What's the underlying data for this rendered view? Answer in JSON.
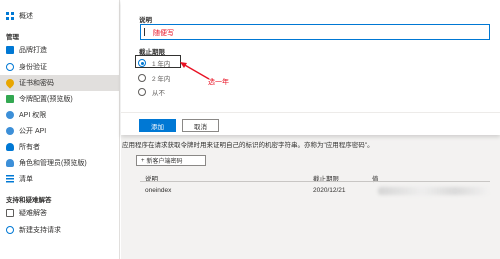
{
  "sidebar": {
    "items": [
      {
        "label": "概述",
        "icon": "grid-icon"
      },
      {
        "label": "品牌打造",
        "icon": "brand-icon"
      },
      {
        "label": "身份验证",
        "icon": "auth-icon"
      },
      {
        "label": "证书和密码",
        "icon": "key-icon",
        "selected": true
      },
      {
        "label": "令牌配置(预览版)",
        "icon": "token-icon"
      },
      {
        "label": "API 权限",
        "icon": "api-icon"
      },
      {
        "label": "公开 API",
        "icon": "cloud-icon"
      },
      {
        "label": "所有者",
        "icon": "owner-icon"
      },
      {
        "label": "角色和管理员(预览版)",
        "icon": "role-icon"
      },
      {
        "label": "清单",
        "icon": "list-icon"
      },
      {
        "label": "疑难解答",
        "icon": "troubleshoot-icon"
      },
      {
        "label": "新建支持请求",
        "icon": "support-icon"
      }
    ],
    "sections": {
      "manage": "管理",
      "support": "支持和疑难解答"
    }
  },
  "panel": {
    "description_label": "说明",
    "description_value": "随便写",
    "expires_label": "截止期限",
    "options": [
      "1 年内",
      "2 年内",
      "从不"
    ],
    "selected_option": "1 年内",
    "annotation": "选一年",
    "add_label": "添加",
    "cancel_label": "取消"
  },
  "background": {
    "description": "应用程序在请求获取令牌时用来证明自己的标识的机密字符串。亦称为\"应用程序密码\"。",
    "new_secret_label": "新客户端密码",
    "table": {
      "headers": [
        "说明",
        "截止期限",
        "值"
      ],
      "rows": [
        {
          "description": "oneindex",
          "expires": "2020/12/21"
        }
      ]
    }
  },
  "colors": {
    "accent": "#0078d4",
    "annotation": "#e81123"
  }
}
